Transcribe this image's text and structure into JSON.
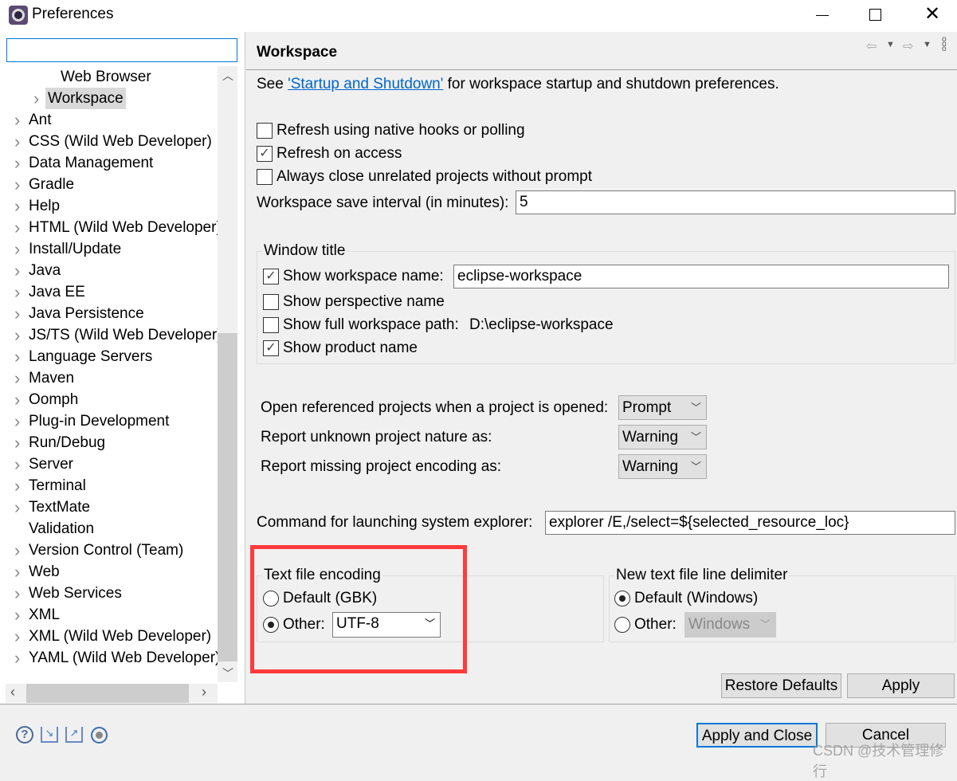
{
  "window": {
    "title": "Preferences",
    "minimize_icon": "minimize",
    "maximize_icon": "maximize",
    "close_icon": "close"
  },
  "sidebar": {
    "filter_value": "",
    "items": [
      {
        "label": "Web Browser",
        "level": 2,
        "expandable": false
      },
      {
        "label": "Workspace",
        "level": 1,
        "expandable": true,
        "selected": true
      },
      {
        "label": "Ant",
        "level": 0,
        "expandable": true
      },
      {
        "label": "CSS (Wild Web Developer)",
        "level": 0,
        "expandable": true
      },
      {
        "label": "Data Management",
        "level": 0,
        "expandable": true
      },
      {
        "label": "Gradle",
        "level": 0,
        "expandable": true
      },
      {
        "label": "Help",
        "level": 0,
        "expandable": true
      },
      {
        "label": "HTML (Wild Web Developer)",
        "level": 0,
        "expandable": true
      },
      {
        "label": "Install/Update",
        "level": 0,
        "expandable": true
      },
      {
        "label": "Java",
        "level": 0,
        "expandable": true
      },
      {
        "label": "Java EE",
        "level": 0,
        "expandable": true
      },
      {
        "label": "Java Persistence",
        "level": 0,
        "expandable": true
      },
      {
        "label": "JS/TS (Wild Web Developer)",
        "level": 0,
        "expandable": true
      },
      {
        "label": "Language Servers",
        "level": 0,
        "expandable": true
      },
      {
        "label": "Maven",
        "level": 0,
        "expandable": true
      },
      {
        "label": "Oomph",
        "level": 0,
        "expandable": true
      },
      {
        "label": "Plug-in Development",
        "level": 0,
        "expandable": true
      },
      {
        "label": "Run/Debug",
        "level": 0,
        "expandable": true
      },
      {
        "label": "Server",
        "level": 0,
        "expandable": true
      },
      {
        "label": "Terminal",
        "level": 0,
        "expandable": true
      },
      {
        "label": "TextMate",
        "level": 0,
        "expandable": true
      },
      {
        "label": "Validation",
        "level": 0,
        "expandable": false
      },
      {
        "label": "Version Control (Team)",
        "level": 0,
        "expandable": true
      },
      {
        "label": "Web",
        "level": 0,
        "expandable": true
      },
      {
        "label": "Web Services",
        "level": 0,
        "expandable": true
      },
      {
        "label": "XML",
        "level": 0,
        "expandable": true
      },
      {
        "label": "XML (Wild Web Developer)",
        "level": 0,
        "expandable": true
      },
      {
        "label": "YAML (Wild Web Developer)",
        "level": 0,
        "expandable": true
      }
    ]
  },
  "page": {
    "title": "Workspace",
    "intro_prefix": "See ",
    "intro_link": "'Startup and Shutdown'",
    "intro_suffix": " for workspace startup and shutdown preferences.",
    "refresh_native": {
      "label": "Refresh using native hooks or polling",
      "checked": false
    },
    "refresh_access": {
      "label": "Refresh on access",
      "checked": true
    },
    "always_close": {
      "label": "Always close unrelated projects without prompt",
      "checked": false
    },
    "save_interval_label": "Workspace save interval (in minutes):",
    "save_interval_value": "5",
    "window_title": {
      "group_label": "Window title",
      "show_workspace_name": {
        "label": "Show workspace name:",
        "checked": true,
        "value": "eclipse-workspace"
      },
      "show_perspective": {
        "label": "Show perspective name",
        "checked": false
      },
      "show_full_path": {
        "label": "Show full workspace path:",
        "checked": false,
        "value": "D:\\eclipse-workspace"
      },
      "show_product": {
        "label": "Show product name",
        "checked": true
      }
    },
    "open_referenced": {
      "label": "Open referenced projects when a project is opened:",
      "value": "Prompt"
    },
    "unknown_nature": {
      "label": "Report unknown project nature as:",
      "value": "Warning"
    },
    "missing_encoding": {
      "label": "Report missing project encoding as:",
      "value": "Warning"
    },
    "explorer_cmd": {
      "label": "Command for launching system explorer:",
      "value": "explorer /E,/select=${selected_resource_loc}"
    },
    "encoding": {
      "group_label": "Text file encoding",
      "default_label": "Default (GBK)",
      "other_label": "Other:",
      "other_value": "UTF-8",
      "selected": "other"
    },
    "delimiter": {
      "group_label": "New text file line delimiter",
      "default_label": "Default (Windows)",
      "other_label": "Other:",
      "other_value": "Windows",
      "selected": "default"
    },
    "restore_defaults": "Restore Defaults",
    "apply": "Apply"
  },
  "footer": {
    "apply_close": "Apply and Close",
    "cancel": "Cancel"
  },
  "highlight_color": "#ff3b3b",
  "link_color": "#0066cc",
  "watermark": "CSDN @技术管理修行"
}
